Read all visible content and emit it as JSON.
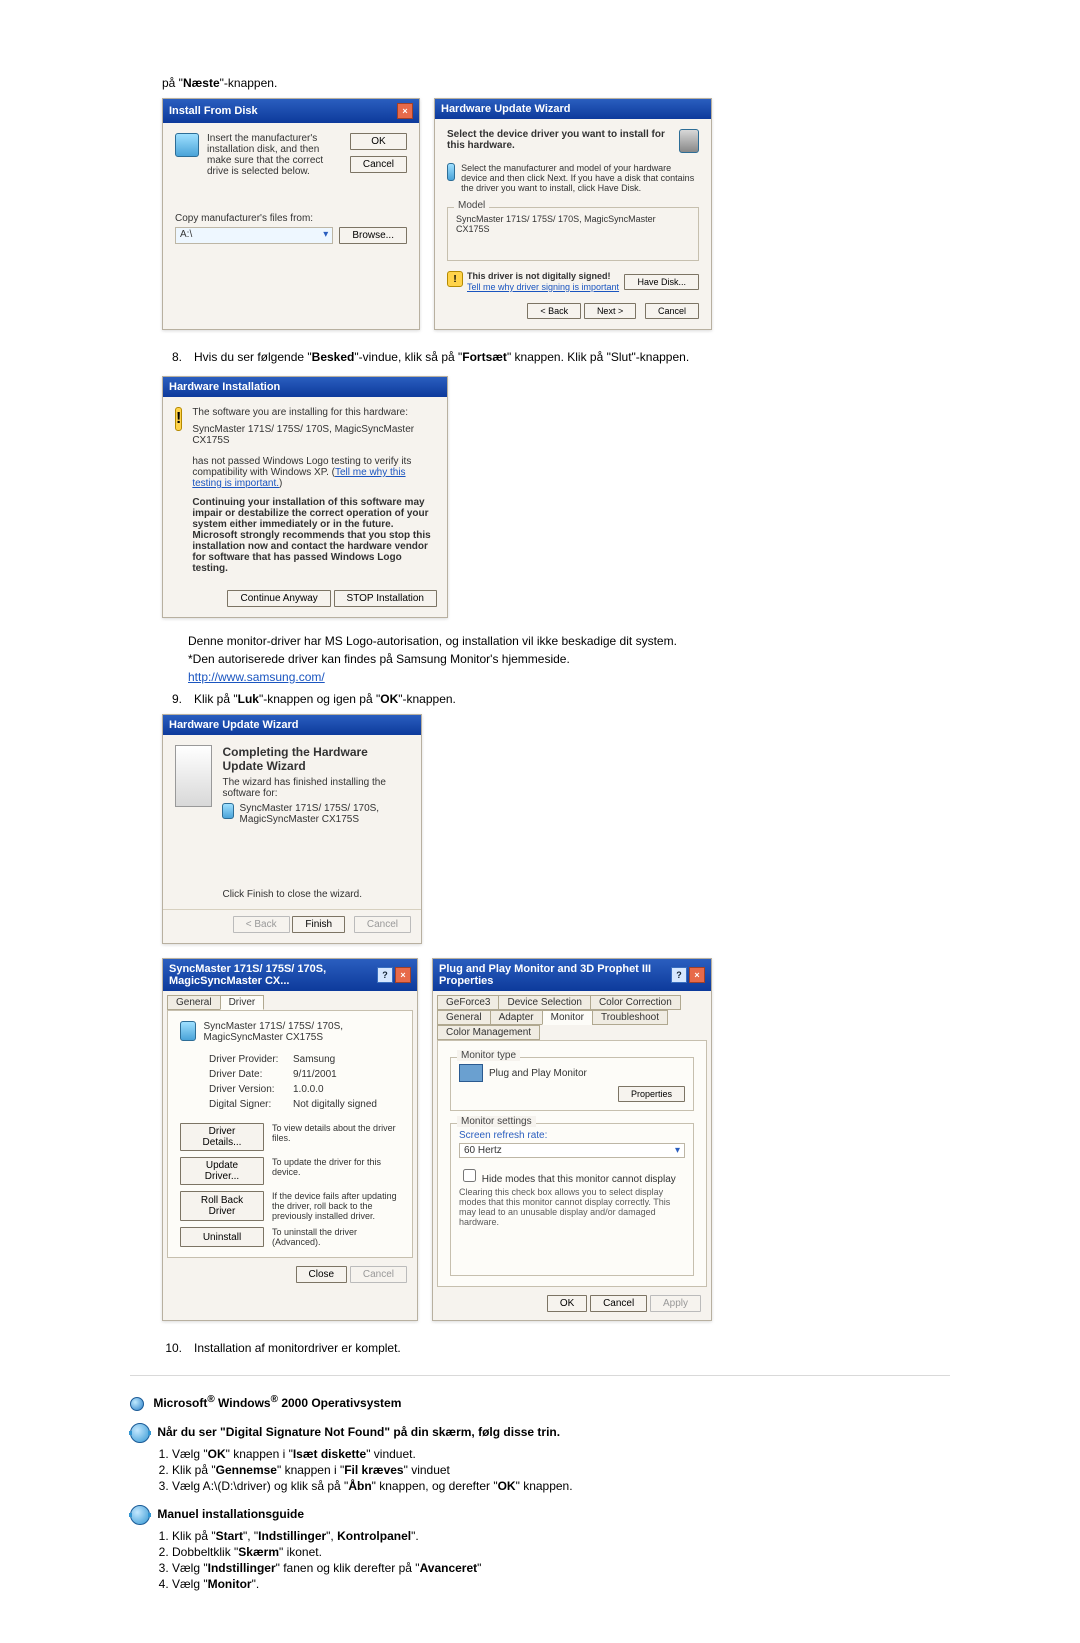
{
  "top_line": {
    "prefix": "på \"",
    "bold": "Næste",
    "suffix": "\"-knappen."
  },
  "install_from_disk": {
    "title": "Install From Disk",
    "text": "Insert the manufacturer's installation disk, and then make sure that the correct drive is selected below.",
    "ok": "OK",
    "cancel": "Cancel",
    "copy_label": "Copy manufacturer's files from:",
    "path_value": "A:\\",
    "browse": "Browse..."
  },
  "hw_update_wizard": {
    "title": "Hardware Update Wizard",
    "instr": "Select the device driver you want to install for this hardware.",
    "desc": "Select the manufacturer and model of your hardware device and then click Next. If you have a disk that contains the driver you want to install, click Have Disk.",
    "model_legend": "Model",
    "model_value": "SyncMaster 171S/ 175S/ 170S, MagicSyncMaster CX175S",
    "warn_text": "This driver is not digitally signed!",
    "warn_link": "Tell me why driver signing is important",
    "have_disk": "Have Disk...",
    "back": "< Back",
    "next": "Next >",
    "cancel": "Cancel"
  },
  "step8": {
    "num": "8.",
    "p1": "Hvis du ser følgende \"",
    "b1": "Besked",
    "p2": "\"-vindue, klik så på \"",
    "b2": "Fortsæt",
    "p3": "\" knappen. Klik på \"Slut\"-knappen."
  },
  "hw_install": {
    "title": "Hardware Installation",
    "line1": "The software you are installing for this hardware:",
    "device": "SyncMaster 171S/ 175S/ 170S, MagicSyncMaster CX175S",
    "line2a": "has not passed Windows Logo testing to verify its compatibility with Windows XP. (",
    "link": "Tell me why this testing is important.",
    "line2b": ")",
    "bold_para": "Continuing your installation of this software may impair or destabilize the correct operation of your system either immediately or in the future. Microsoft strongly recommends that you stop this installation now and contact the hardware vendor for software that has passed Windows Logo testing.",
    "continue": "Continue Anyway",
    "stop": "STOP Installation"
  },
  "mid_text": {
    "l1": "Denne monitor-driver har MS Logo-autorisation, og installation vil ikke beskadige dit system.",
    "l2": "*Den autoriserede driver kan findes på Samsung Monitor's hjemmeside.",
    "link": "http://www.samsung.com/"
  },
  "step9": {
    "num": "9.",
    "p1": "Klik på \"",
    "b1": "Luk",
    "p2": "\"-knappen og igen på \"",
    "b2": "OK",
    "p3": "\"-knappen."
  },
  "hw_complete": {
    "title": "Hardware Update Wizard",
    "heading": "Completing the Hardware Update Wizard",
    "line1": "The wizard has finished installing the software for:",
    "device": "SyncMaster 171S/ 175S/ 170S, MagicSyncMaster CX175S",
    "line2": "Click Finish to close the wizard.",
    "back": "< Back",
    "finish": "Finish",
    "cancel": "Cancel"
  },
  "driver_props": {
    "title": "SyncMaster 171S/ 175S/ 170S, MagicSyncMaster CX...",
    "tab_general": "General",
    "tab_driver": "Driver",
    "device": "SyncMaster 171S/ 175S/ 170S, MagicSyncMaster CX175S",
    "k_provider": "Driver Provider:",
    "v_provider": "Samsung",
    "k_date": "Driver Date:",
    "v_date": "9/11/2001",
    "k_version": "Driver Version:",
    "v_version": "1.0.0.0",
    "k_signer": "Digital Signer:",
    "v_signer": "Not digitally signed",
    "btn_details": "Driver Details...",
    "t_details": "To view details about the driver files.",
    "btn_update": "Update Driver...",
    "t_update": "To update the driver for this device.",
    "btn_rollback": "Roll Back Driver",
    "t_rollback": "If the device fails after updating the driver, roll back to the previously installed driver.",
    "btn_uninstall": "Uninstall",
    "t_uninstall": "To uninstall the driver (Advanced).",
    "close": "Close",
    "cancel": "Cancel"
  },
  "pnp": {
    "title": "Plug and Play Monitor and 3D Prophet III Properties",
    "tabs": {
      "geforce": "GeForce3",
      "device_sel": "Device Selection",
      "color_corr": "Color Correction",
      "general": "General",
      "adapter": "Adapter",
      "monitor": "Monitor",
      "trouble": "Troubleshoot",
      "color_mgmt": "Color Management"
    },
    "grp_monitor": "Monitor type",
    "monitor_name": "Plug and Play Monitor",
    "properties": "Properties",
    "grp_settings": "Monitor settings",
    "refresh_label": "Screen refresh rate:",
    "refresh_value": "60 Hertz",
    "chk_label": "Hide modes that this monitor cannot display",
    "chk_desc": "Clearing this check box allows you to select display modes that this monitor cannot display correctly. This may lead to an unusable display and/or damaged hardware.",
    "ok": "OK",
    "cancel": "Cancel",
    "apply": "Apply"
  },
  "step10": {
    "num": "10.",
    "text": "Installation af monitordriver er komplet."
  },
  "win2000": {
    "heading_pre": "Microsoft",
    "reg1": "®",
    "heading_mid": " Windows",
    "reg2": "®",
    "heading_post": " 2000 Operativsystem"
  },
  "sig_section": {
    "heading": "Når du ser \"Digital Signature Not Found\" på din skærm, følg disse trin.",
    "items": [
      {
        "pre": "Vælg \"",
        "b": "OK",
        "mid": "\" knappen i \"",
        "b2": "Isæt diskette",
        "post": "\" vinduet."
      },
      {
        "pre": "Klik på \"",
        "b": "Gennemse",
        "mid": "\" knappen i \"",
        "b2": "Fil kræves",
        "post": "\" vinduet"
      },
      {
        "pre": "Vælg A:\\(D:\\driver) og klik så på \"",
        "b": "Åbn",
        "mid": "\" knappen, og derefter \"",
        "b2": "OK",
        "post": "\" knappen."
      }
    ]
  },
  "manual_section": {
    "heading": "Manuel installationsguide",
    "items": [
      {
        "pre": "Klik på \"",
        "b": "Start",
        "mid": "\", \"",
        "b2": "Indstillinger",
        "mid2": "\", ",
        "b3": "Kontrolpanel",
        "post": "\"."
      },
      {
        "pre": "Dobbeltklik \"",
        "b": "Skærm",
        "post": "\" ikonet."
      },
      {
        "pre": "Vælg \"",
        "b": "Indstillinger",
        "mid": "\" fanen og klik derefter på \"",
        "b2": "Avanceret",
        "post": "\""
      },
      {
        "pre": "Vælg \"",
        "b": "Monitor",
        "post": "\"."
      }
    ]
  }
}
